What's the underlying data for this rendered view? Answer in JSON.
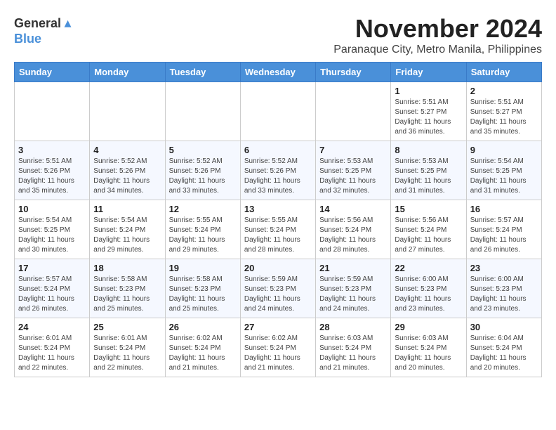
{
  "logo": {
    "general": "General",
    "blue": "Blue"
  },
  "title": {
    "month": "November 2024",
    "location": "Paranaque City, Metro Manila, Philippines"
  },
  "headers": [
    "Sunday",
    "Monday",
    "Tuesday",
    "Wednesday",
    "Thursday",
    "Friday",
    "Saturday"
  ],
  "weeks": [
    [
      {
        "day": "",
        "info": ""
      },
      {
        "day": "",
        "info": ""
      },
      {
        "day": "",
        "info": ""
      },
      {
        "day": "",
        "info": ""
      },
      {
        "day": "",
        "info": ""
      },
      {
        "day": "1",
        "info": "Sunrise: 5:51 AM\nSunset: 5:27 PM\nDaylight: 11 hours\nand 36 minutes."
      },
      {
        "day": "2",
        "info": "Sunrise: 5:51 AM\nSunset: 5:27 PM\nDaylight: 11 hours\nand 35 minutes."
      }
    ],
    [
      {
        "day": "3",
        "info": "Sunrise: 5:51 AM\nSunset: 5:26 PM\nDaylight: 11 hours\nand 35 minutes."
      },
      {
        "day": "4",
        "info": "Sunrise: 5:52 AM\nSunset: 5:26 PM\nDaylight: 11 hours\nand 34 minutes."
      },
      {
        "day": "5",
        "info": "Sunrise: 5:52 AM\nSunset: 5:26 PM\nDaylight: 11 hours\nand 33 minutes."
      },
      {
        "day": "6",
        "info": "Sunrise: 5:52 AM\nSunset: 5:26 PM\nDaylight: 11 hours\nand 33 minutes."
      },
      {
        "day": "7",
        "info": "Sunrise: 5:53 AM\nSunset: 5:25 PM\nDaylight: 11 hours\nand 32 minutes."
      },
      {
        "day": "8",
        "info": "Sunrise: 5:53 AM\nSunset: 5:25 PM\nDaylight: 11 hours\nand 31 minutes."
      },
      {
        "day": "9",
        "info": "Sunrise: 5:54 AM\nSunset: 5:25 PM\nDaylight: 11 hours\nand 31 minutes."
      }
    ],
    [
      {
        "day": "10",
        "info": "Sunrise: 5:54 AM\nSunset: 5:25 PM\nDaylight: 11 hours\nand 30 minutes."
      },
      {
        "day": "11",
        "info": "Sunrise: 5:54 AM\nSunset: 5:24 PM\nDaylight: 11 hours\nand 29 minutes."
      },
      {
        "day": "12",
        "info": "Sunrise: 5:55 AM\nSunset: 5:24 PM\nDaylight: 11 hours\nand 29 minutes."
      },
      {
        "day": "13",
        "info": "Sunrise: 5:55 AM\nSunset: 5:24 PM\nDaylight: 11 hours\nand 28 minutes."
      },
      {
        "day": "14",
        "info": "Sunrise: 5:56 AM\nSunset: 5:24 PM\nDaylight: 11 hours\nand 28 minutes."
      },
      {
        "day": "15",
        "info": "Sunrise: 5:56 AM\nSunset: 5:24 PM\nDaylight: 11 hours\nand 27 minutes."
      },
      {
        "day": "16",
        "info": "Sunrise: 5:57 AM\nSunset: 5:24 PM\nDaylight: 11 hours\nand 26 minutes."
      }
    ],
    [
      {
        "day": "17",
        "info": "Sunrise: 5:57 AM\nSunset: 5:24 PM\nDaylight: 11 hours\nand 26 minutes."
      },
      {
        "day": "18",
        "info": "Sunrise: 5:58 AM\nSunset: 5:23 PM\nDaylight: 11 hours\nand 25 minutes."
      },
      {
        "day": "19",
        "info": "Sunrise: 5:58 AM\nSunset: 5:23 PM\nDaylight: 11 hours\nand 25 minutes."
      },
      {
        "day": "20",
        "info": "Sunrise: 5:59 AM\nSunset: 5:23 PM\nDaylight: 11 hours\nand 24 minutes."
      },
      {
        "day": "21",
        "info": "Sunrise: 5:59 AM\nSunset: 5:23 PM\nDaylight: 11 hours\nand 24 minutes."
      },
      {
        "day": "22",
        "info": "Sunrise: 6:00 AM\nSunset: 5:23 PM\nDaylight: 11 hours\nand 23 minutes."
      },
      {
        "day": "23",
        "info": "Sunrise: 6:00 AM\nSunset: 5:23 PM\nDaylight: 11 hours\nand 23 minutes."
      }
    ],
    [
      {
        "day": "24",
        "info": "Sunrise: 6:01 AM\nSunset: 5:24 PM\nDaylight: 11 hours\nand 22 minutes."
      },
      {
        "day": "25",
        "info": "Sunrise: 6:01 AM\nSunset: 5:24 PM\nDaylight: 11 hours\nand 22 minutes."
      },
      {
        "day": "26",
        "info": "Sunrise: 6:02 AM\nSunset: 5:24 PM\nDaylight: 11 hours\nand 21 minutes."
      },
      {
        "day": "27",
        "info": "Sunrise: 6:02 AM\nSunset: 5:24 PM\nDaylight: 11 hours\nand 21 minutes."
      },
      {
        "day": "28",
        "info": "Sunrise: 6:03 AM\nSunset: 5:24 PM\nDaylight: 11 hours\nand 21 minutes."
      },
      {
        "day": "29",
        "info": "Sunrise: 6:03 AM\nSunset: 5:24 PM\nDaylight: 11 hours\nand 20 minutes."
      },
      {
        "day": "30",
        "info": "Sunrise: 6:04 AM\nSunset: 5:24 PM\nDaylight: 11 hours\nand 20 minutes."
      }
    ]
  ]
}
